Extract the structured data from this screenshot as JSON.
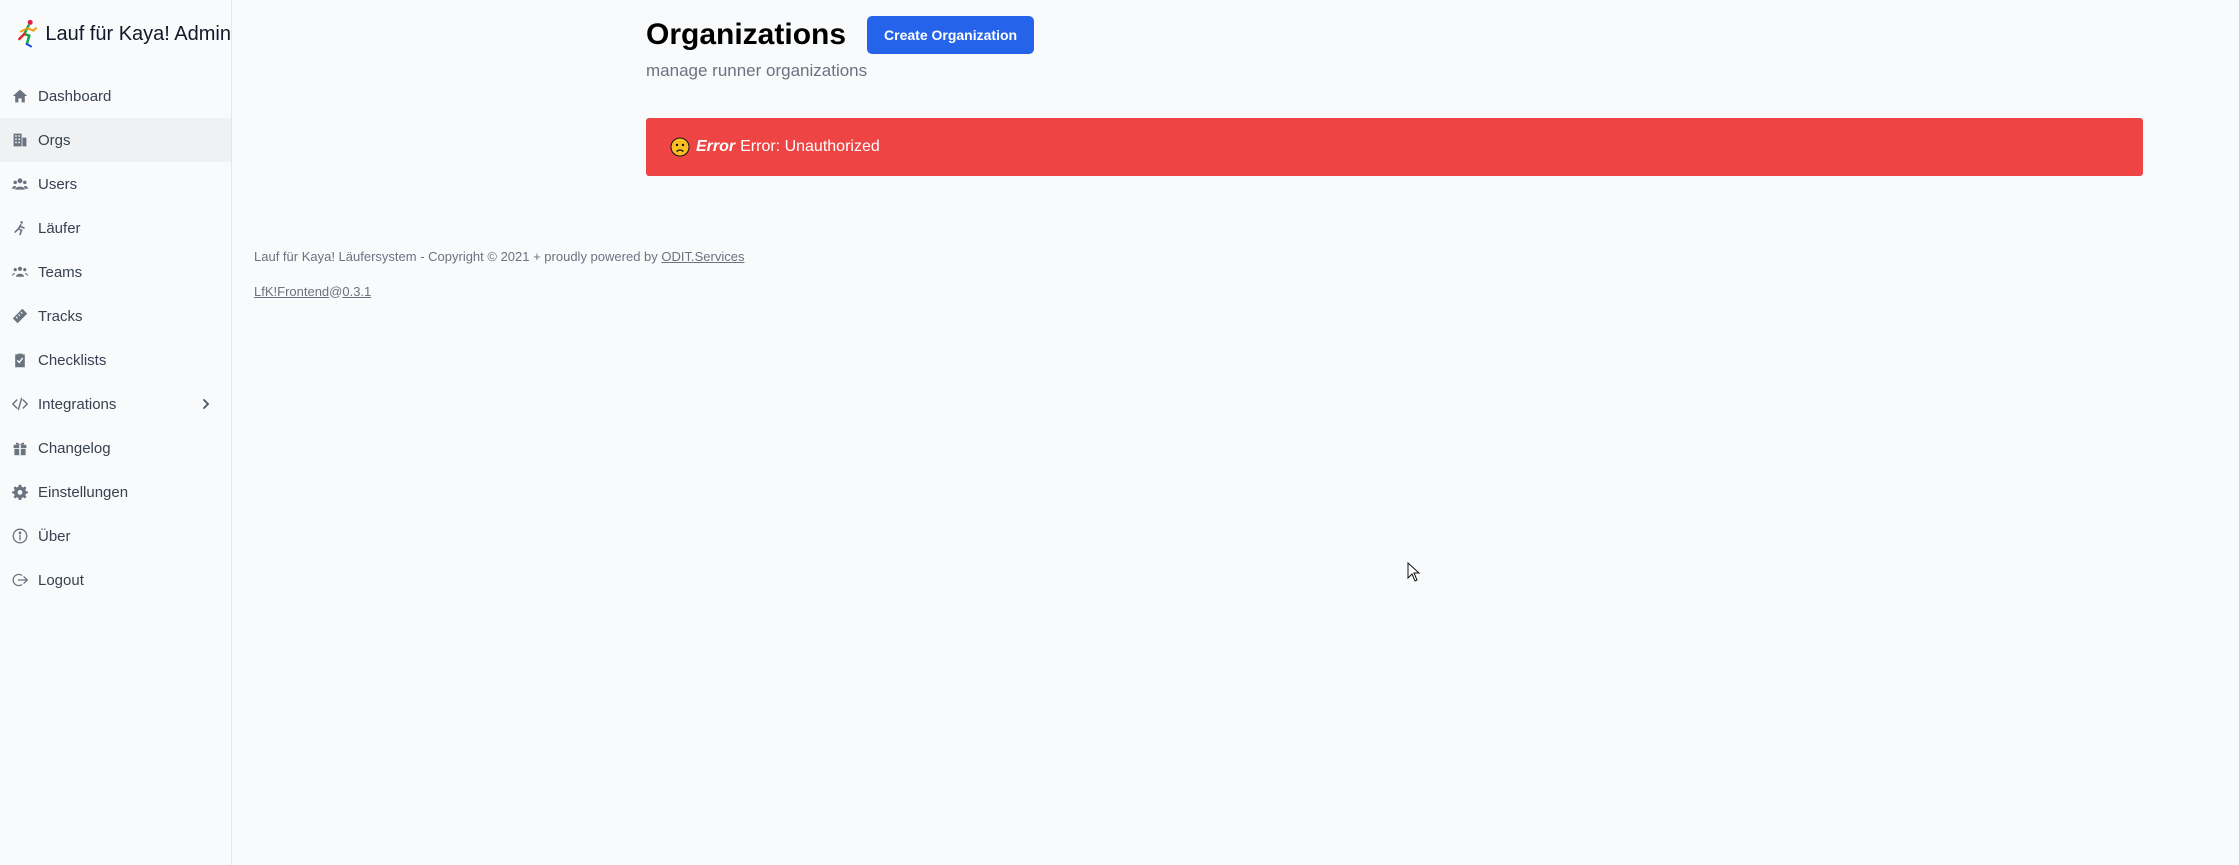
{
  "brand": {
    "title": "Lauf für Kaya! Admin"
  },
  "sidebar": {
    "items": [
      {
        "label": "Dashboard",
        "icon": "home-icon"
      },
      {
        "label": "Orgs",
        "icon": "building-icon",
        "active": true
      },
      {
        "label": "Users",
        "icon": "users-icon"
      },
      {
        "label": "Läufer",
        "icon": "runner-icon"
      },
      {
        "label": "Teams",
        "icon": "team-icon"
      },
      {
        "label": "Tracks",
        "icon": "ruler-icon"
      },
      {
        "label": "Checklists",
        "icon": "clipboard-check-icon"
      },
      {
        "label": "Integrations",
        "icon": "code-icon",
        "has_submenu": true
      },
      {
        "label": "Changelog",
        "icon": "gift-icon"
      },
      {
        "label": "Einstellungen",
        "icon": "gear-icon"
      },
      {
        "label": "Über",
        "icon": "info-icon"
      },
      {
        "label": "Logout",
        "icon": "logout-icon"
      }
    ]
  },
  "header": {
    "title": "Organizations",
    "create_label": "Create Organization",
    "subtitle": "manage runner organizations"
  },
  "error": {
    "emoji": "😟",
    "strong": "Error",
    "message": "Error: Unauthorized",
    "color": "#ef4444"
  },
  "footer": {
    "text": "Lauf für Kaya! Läufersystem - Copyright © 2021 + proudly powered by",
    "link_label": "ODIT.Services",
    "version_name": "LfK!Frontend",
    "version_at": "@",
    "version_number": "0.3.1"
  },
  "colors": {
    "accent": "#2563eb",
    "error": "#ef4444"
  }
}
